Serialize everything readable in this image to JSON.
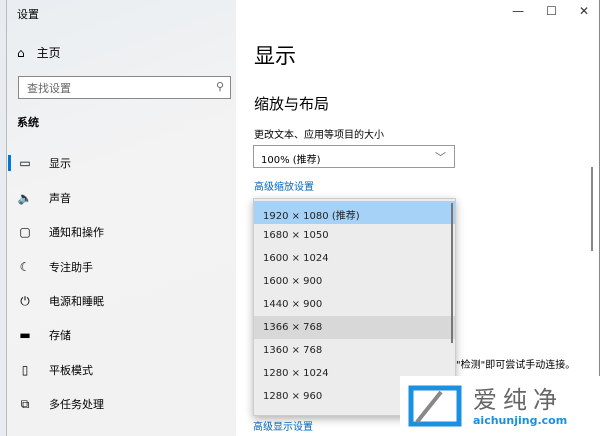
{
  "window": {
    "title": "设置",
    "minimize": "—",
    "maximize": "☐",
    "close": "✕"
  },
  "sidebar": {
    "home": "主页",
    "search_placeholder": "查找设置",
    "section": "系统",
    "items": [
      {
        "icon": "monitor-icon",
        "glyph": "▭",
        "label": "显示"
      },
      {
        "icon": "speaker-icon",
        "glyph": "🔈",
        "label": "声音"
      },
      {
        "icon": "notification-icon",
        "glyph": "▢",
        "label": "通知和操作"
      },
      {
        "icon": "moon-icon",
        "glyph": "☾",
        "label": "专注助手"
      },
      {
        "icon": "power-icon",
        "glyph": "⏻",
        "label": "电源和睡眠"
      },
      {
        "icon": "storage-icon",
        "glyph": "▬",
        "label": "存储"
      },
      {
        "icon": "tablet-icon",
        "glyph": "▯",
        "label": "平板模式"
      },
      {
        "icon": "multitask-icon",
        "glyph": "⧉",
        "label": "多任务处理"
      }
    ]
  },
  "main": {
    "title": "显示",
    "section": "缩放与布局",
    "scale_label": "更改文本、应用等项目的大小",
    "scale_value": "100% (推荐)",
    "advanced_scaling": "高级缩放设置",
    "bg_text": "\"检测\"即可尝试手动连接。",
    "advanced_display": "高级显示设置"
  },
  "resolution_options": [
    "1920 × 1080 (推荐)",
    "1680 × 1050",
    "1600 × 1024",
    "1600 × 900",
    "1440 × 900",
    "1366 × 768",
    "1360 × 768",
    "1280 × 1024",
    "1280 × 960"
  ],
  "watermark": {
    "cn": "爱纯净",
    "en": "aichunjing.com"
  }
}
